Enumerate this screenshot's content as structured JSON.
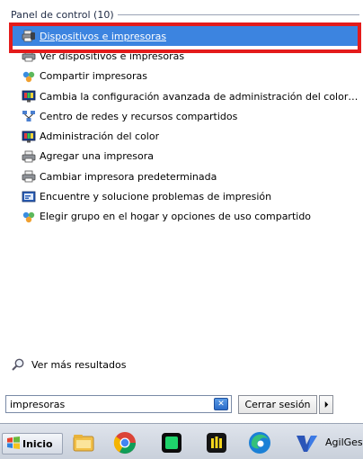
{
  "group": {
    "title": "Panel de control (10)"
  },
  "results": [
    {
      "label": "Dispositivos e impresoras",
      "icon": "devices-printers-icon",
      "selected": true
    },
    {
      "label": "Ver dispositivos e impresoras",
      "icon": "printer-icon",
      "selected": false
    },
    {
      "label": "Compartir impresoras",
      "icon": "homegroup-icon",
      "selected": false
    },
    {
      "label": "Cambia la configuración avanzada de administración del color p...",
      "icon": "color-management-icon",
      "selected": false
    },
    {
      "label": "Centro de redes y recursos compartidos",
      "icon": "network-icon",
      "selected": false
    },
    {
      "label": "Administración del color",
      "icon": "color-management-icon",
      "selected": false
    },
    {
      "label": "Agregar una impresora",
      "icon": "printer-icon",
      "selected": false
    },
    {
      "label": "Cambiar impresora predeterminada",
      "icon": "printer-icon",
      "selected": false
    },
    {
      "label": "Encuentre y solucione problemas de impresión",
      "icon": "troubleshoot-icon",
      "selected": false
    },
    {
      "label": "Elegir grupo en el hogar y opciones de uso compartido",
      "icon": "homegroup-icon",
      "selected": false
    }
  ],
  "more_results": {
    "label": "Ver más resultados"
  },
  "search": {
    "value": "impresoras",
    "clear_icon": "clear-search-icon"
  },
  "logoff": {
    "label": "Cerrar sesión"
  },
  "taskbar": {
    "start_label": "Inicio",
    "apps": [
      {
        "name": "file-explorer-icon"
      },
      {
        "name": "chrome-icon"
      },
      {
        "name": "green-app-icon"
      },
      {
        "name": "yellow-bars-app-icon"
      },
      {
        "name": "edge-icon"
      },
      {
        "name": "agilgest-icon"
      }
    ],
    "agil_label": "AgilGest"
  },
  "colors": {
    "selection": "#3c84e0",
    "highlight_box": "#e41b1b"
  }
}
